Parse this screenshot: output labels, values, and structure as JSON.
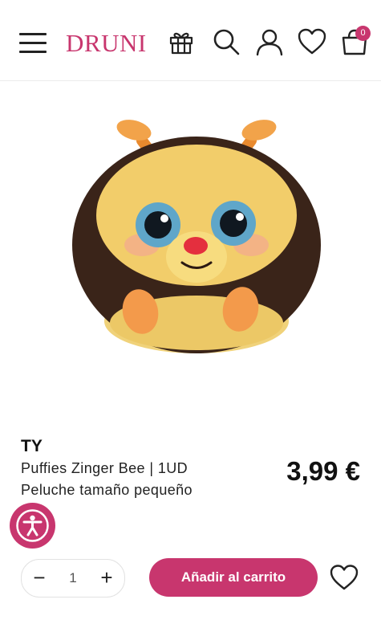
{
  "header": {
    "logo_text": "DRUNI",
    "cart_count": "0",
    "icons": [
      "menu-icon",
      "gift-icon",
      "search-icon",
      "user-icon",
      "heart-icon",
      "bag-icon"
    ]
  },
  "product": {
    "brand": "TY",
    "name": "Puffies Zinger Bee  | 1UD",
    "description": "Peluche tamaño pequeño",
    "price": "3,99 €",
    "image_alt": "Puffies Zinger Bee"
  },
  "purchase": {
    "minus_label": "−",
    "quantity": "1",
    "plus_label": "+",
    "add_to_cart_label": "Añadir al carrito"
  },
  "colors": {
    "accent": "#c8366e",
    "text": "#111111",
    "border": "#e2e2e2"
  }
}
